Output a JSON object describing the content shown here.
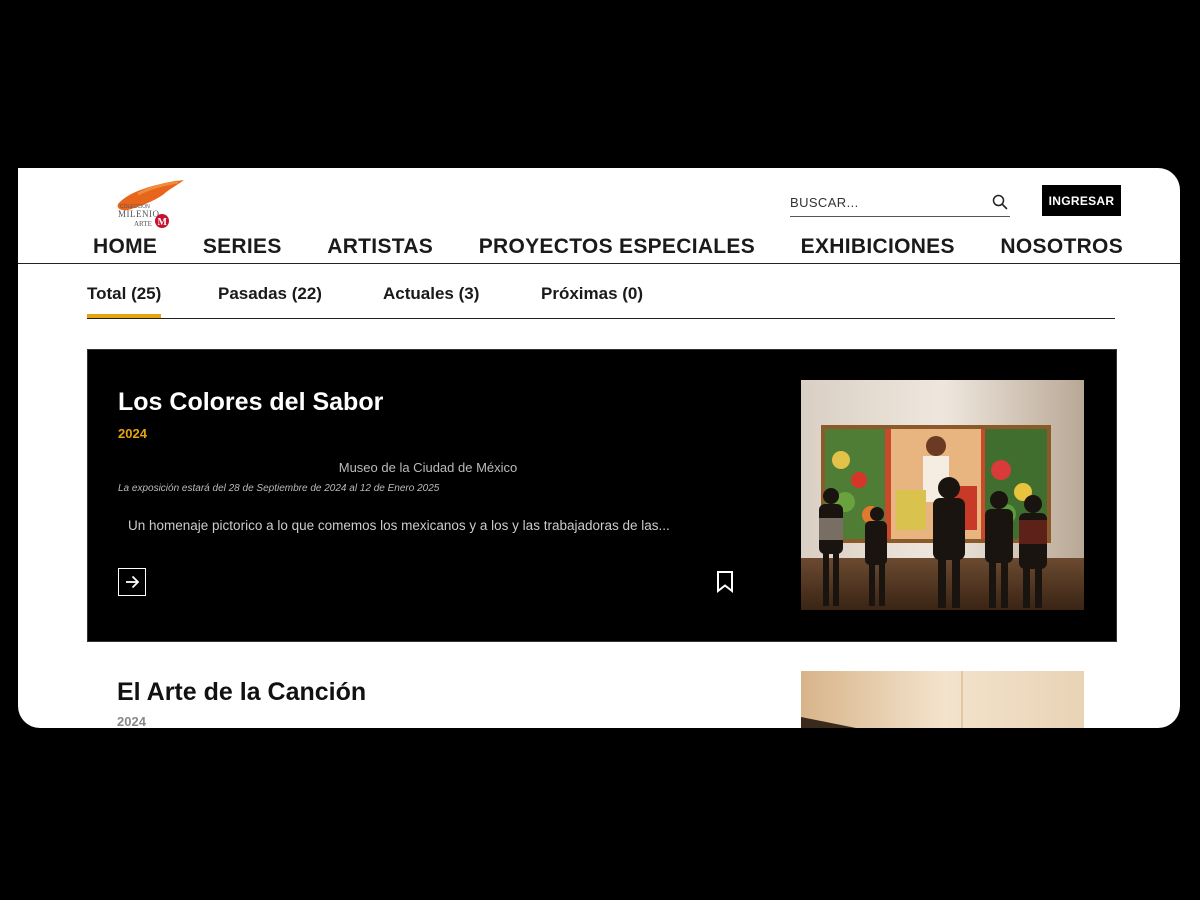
{
  "header": {
    "logo_text": [
      "COLECCIÓN",
      "MILENIO",
      "ARTE",
      "M"
    ],
    "search": {
      "placeholder": "BUSCAR..."
    },
    "login_label": "INGRESAR"
  },
  "nav": {
    "items": [
      "HOME",
      "SERIES",
      "ARTISTAS",
      "PROYECTOS ESPECIALES",
      "EXHIBICIONES",
      "NOSOTROS"
    ]
  },
  "tabs": [
    {
      "label": "Total (25)",
      "active": true
    },
    {
      "label": "Pasadas (22)",
      "active": false
    },
    {
      "label": "Actuales (3)",
      "active": false
    },
    {
      "label": "Próximas (0)",
      "active": false
    }
  ],
  "exhibitions": [
    {
      "title": "Los Colores del Sabor",
      "year": "2024",
      "venue": "Museo de la Ciudad de México",
      "dates": "La exposición estará del 28 de Septiembre de 2024 al 12 de Enero 2025",
      "description": "Un homenaje pictorico a lo que comemos los mexicanos y a los y las trabajadoras de las..."
    },
    {
      "title": "El Arte de la Canción",
      "year": "2024"
    }
  ],
  "colors": {
    "accent": "#e5a50c",
    "logo_orange": "#e8661c",
    "logo_red": "#c8102e",
    "card_bg": "#000000"
  },
  "icons": {
    "search": "search-icon",
    "arrow": "arrow-right-icon",
    "bookmark": "bookmark-icon"
  }
}
